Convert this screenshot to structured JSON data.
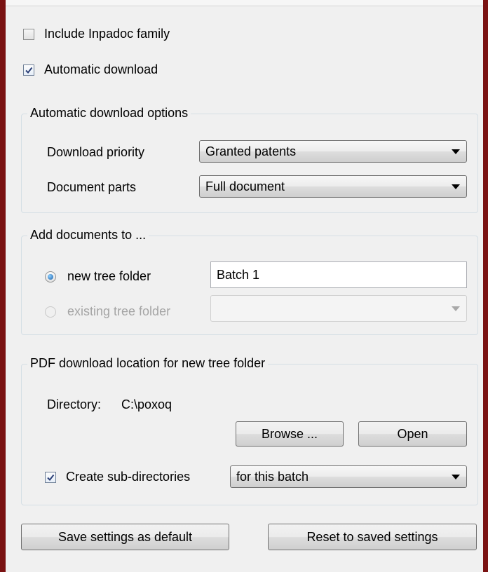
{
  "options": {
    "include_inpadoc": {
      "label": "Include Inpadoc family",
      "checked": false
    },
    "automatic_download": {
      "label": "Automatic download",
      "checked": true
    }
  },
  "auto_download_options": {
    "legend": "Automatic download options",
    "priority_label": "Download priority",
    "priority_value": "Granted patents",
    "parts_label": "Document parts",
    "parts_value": "Full document"
  },
  "add_documents": {
    "legend": "Add documents to ...",
    "new_folder_label": "new tree folder",
    "new_folder_value": "Batch 1",
    "existing_folder_label": "existing tree folder",
    "existing_folder_value": ""
  },
  "pdf_location": {
    "legend": "PDF download location for new tree folder",
    "directory_label": "Directory:",
    "directory_value": "C:\\poxoq",
    "browse_label": "Browse ...",
    "open_label": "Open",
    "subdirs_label": "Create sub-directories",
    "subdirs_checked": true,
    "subdirs_value": "for this batch"
  },
  "footer": {
    "save_label": "Save settings as default",
    "reset_label": "Reset to saved settings"
  },
  "colors": {
    "border_accent": "#7a1212",
    "group_border": "#d5dfe5",
    "radio_selected": "#1a5fa8"
  }
}
